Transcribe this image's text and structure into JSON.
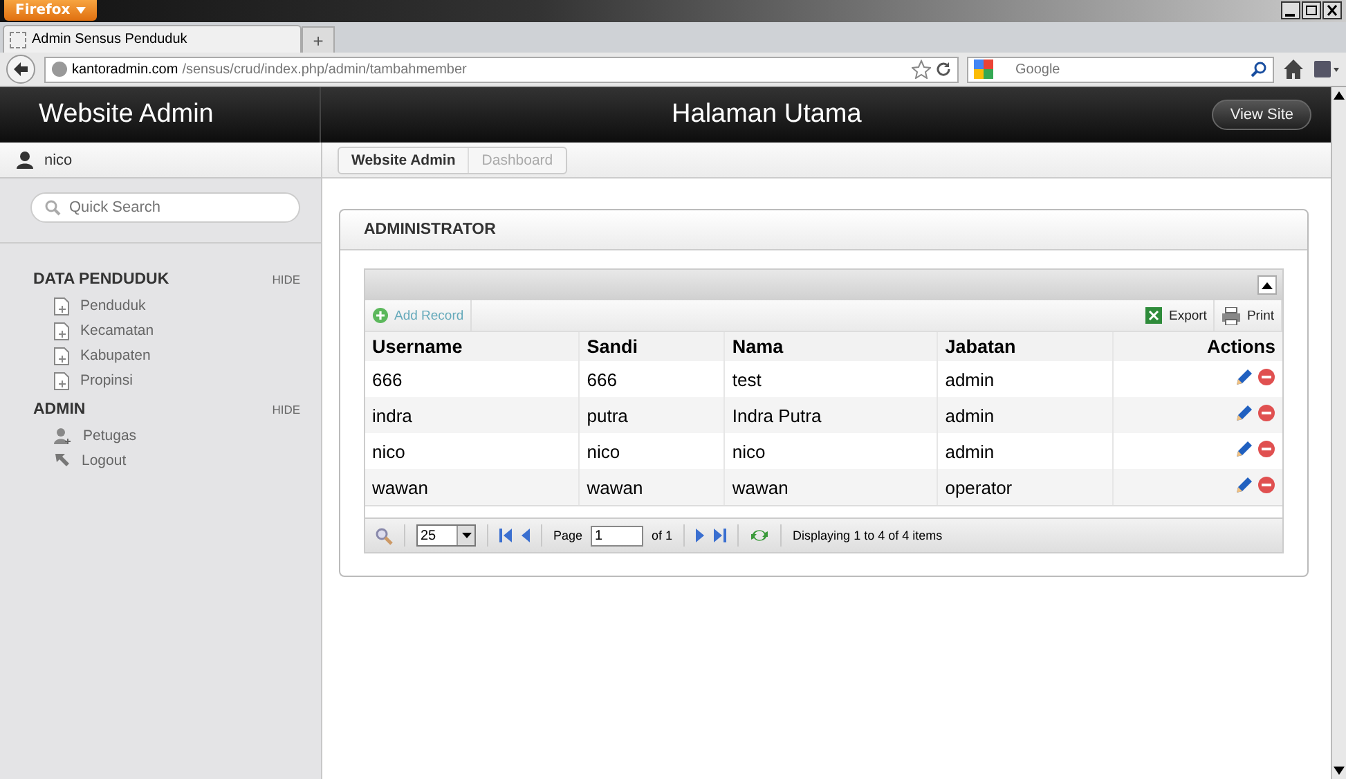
{
  "browser": {
    "menu_button": "Firefox",
    "tab": {
      "title": "Admin Sensus Penduduk"
    },
    "new_tab": "+",
    "url_domain": "kantoradmin.com",
    "url_path": "/sensus/crud/index.php/admin/tambahmember",
    "search": {
      "placeholder": "Google"
    }
  },
  "header": {
    "site_title": "Website Admin",
    "page_title": "Halaman Utama",
    "view_site": "View Site"
  },
  "user": {
    "name": "nico"
  },
  "sidebar": {
    "search": {
      "placeholder": "Quick Search"
    },
    "sections": [
      {
        "title": "DATA PENDUDUK",
        "hide": "HIDE",
        "items": [
          {
            "label": "Penduduk",
            "kind": "page"
          },
          {
            "label": "Kecamatan",
            "kind": "page"
          },
          {
            "label": "Kabupaten",
            "kind": "page"
          },
          {
            "label": "Propinsi",
            "kind": "page"
          }
        ]
      },
      {
        "title": "ADMIN",
        "hide": "HIDE",
        "items": [
          {
            "label": "Petugas",
            "kind": "user"
          },
          {
            "label": "Logout",
            "kind": "logout"
          }
        ]
      }
    ]
  },
  "breadcrumbs": [
    {
      "label": "Website Admin",
      "selected": true
    },
    {
      "label": "Dashboard",
      "selected": false
    }
  ],
  "panel": {
    "title": "ADMINISTRATOR",
    "toolbar": {
      "add": "Add Record",
      "export": "Export",
      "print": "Print"
    },
    "table": {
      "columns": [
        "Username",
        "Sandi",
        "Nama",
        "Jabatan",
        "Actions"
      ],
      "rows": [
        [
          "666",
          "666",
          "test",
          "admin"
        ],
        [
          "indra",
          "putra",
          "Indra Putra",
          "admin"
        ],
        [
          "nico",
          "nico",
          "nico",
          "admin"
        ],
        [
          "wawan",
          "wawan",
          "wawan",
          "operator"
        ]
      ]
    },
    "pager": {
      "page_size": "25",
      "page_label": "Page",
      "page": "1",
      "of": "of 1",
      "status": "Displaying 1 to 4 of 4 items"
    }
  }
}
